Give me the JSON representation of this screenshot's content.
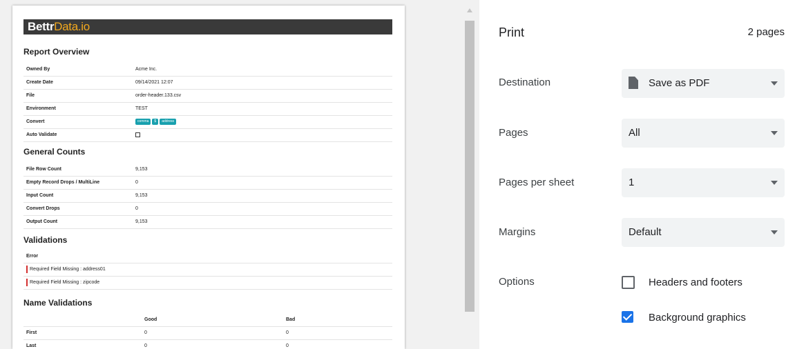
{
  "report": {
    "logo": {
      "a": "Bettr",
      "b": "D",
      "c": "ata.io"
    },
    "overview_title": "Report Overview",
    "overview": [
      {
        "k": "Owned By",
        "v": "Acme Inc."
      },
      {
        "k": "Create Date",
        "v": "09/14/2021 12:07"
      },
      {
        "k": "File",
        "v": "order-header.133.csv"
      },
      {
        "k": "Environment",
        "v": "TEST"
      }
    ],
    "convert_label": "Convert",
    "convert_tags": [
      "comma",
      "$",
      "address"
    ],
    "auto_validate_label": "Auto Validate",
    "general_title": "General Counts",
    "counts": [
      {
        "k": "File Row Count",
        "v": "9,153"
      },
      {
        "k": "Empty Record Drops / MultiLine",
        "v": "0"
      },
      {
        "k": "Input Count",
        "v": "9,153"
      },
      {
        "k": "Convert Drops",
        "v": "0"
      },
      {
        "k": "Output Count",
        "v": "9,153"
      }
    ],
    "validations_title": "Validations",
    "validations_header": "Error",
    "validations": [
      "Required Field Missing : address01",
      "Required Field Missing : zipcode"
    ],
    "name_validations_title": "Name Validations",
    "name_header": [
      "",
      "Good",
      "Bad"
    ],
    "name_rows": [
      [
        "First",
        "0",
        "0"
      ],
      [
        "Last",
        "0",
        "0"
      ]
    ]
  },
  "settings": {
    "title": "Print",
    "pages_count": "2 pages",
    "destination_label": "Destination",
    "destination_value": "Save as PDF",
    "pages_label": "Pages",
    "pages_value": "All",
    "pps_label": "Pages per sheet",
    "pps_value": "1",
    "margins_label": "Margins",
    "margins_value": "Default",
    "options_label": "Options",
    "headers_footers_label": "Headers and footers",
    "headers_footers_checked": false,
    "bg_graphics_label": "Background graphics",
    "bg_graphics_checked": true
  },
  "icons": {
    "destination": "pdf-document-icon",
    "caret": "chevron-down-icon",
    "scroll_up": "scroll-up-arrow-icon"
  },
  "colors": {
    "accent": "#1a73e8",
    "tag": "#18a0ae",
    "error_bar": "#d32f2f",
    "logo_accent": "#f2a81d"
  }
}
